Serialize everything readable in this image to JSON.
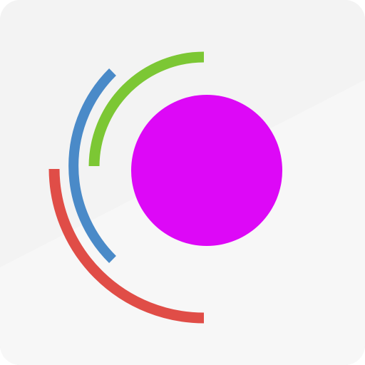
{
  "app": {
    "type": "app-icon"
  },
  "colors": {
    "background_top": "#f3f3f3",
    "background_bottom": "#f7f7f7",
    "ball": "#dd08f7",
    "ring_inner": "#7cc734",
    "ring_middle": "#4a8ac8",
    "ring_outer": "#e04d47"
  },
  "icons": {
    "ball": "ball-icon",
    "ring_inner": "green-arc-icon",
    "ring_middle": "blue-arc-icon",
    "ring_outer": "red-arc-icon"
  }
}
